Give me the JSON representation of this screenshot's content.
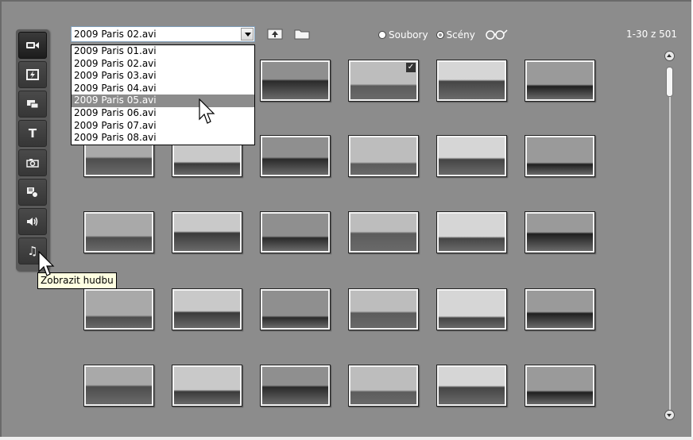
{
  "toolbar": {
    "buttons": [
      {
        "name": "video-icon"
      },
      {
        "name": "transitions-icon"
      },
      {
        "name": "overlay-icon"
      },
      {
        "name": "title-icon",
        "glyph": "T"
      },
      {
        "name": "camera-icon"
      },
      {
        "name": "disc-menu-icon"
      },
      {
        "name": "sound-effects-icon"
      },
      {
        "name": "music-icon",
        "glyph": "♫"
      }
    ],
    "tooltip": "Zobrazit hudbu"
  },
  "file_select": {
    "value": "2009 Paris 02.avi",
    "options": [
      "2009 Paris 01.avi",
      "2009 Paris 02.avi",
      "2009 Paris 03.avi",
      "2009 Paris 04.avi",
      "2009 Paris 05.avi",
      "2009 Paris 06.avi",
      "2009 Paris 07.avi",
      "2009 Paris 08.avi"
    ],
    "highlighted": "2009 Paris 05.avi"
  },
  "view_mode": {
    "options": [
      "Soubory",
      "Scény"
    ],
    "selected": "Scény"
  },
  "pager": {
    "text": "1-30 z 501"
  },
  "colors": {
    "panel": "#8c8c8c",
    "toolbar": "#5a5a5a",
    "tooltip": "#ffffe1",
    "highlight": "#8c8c8c"
  }
}
